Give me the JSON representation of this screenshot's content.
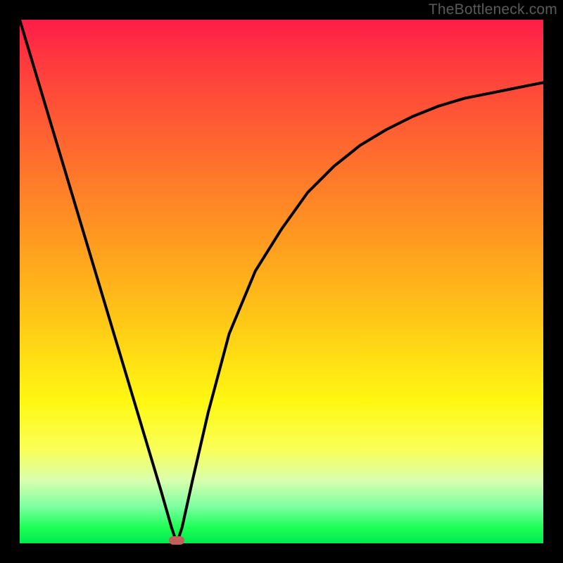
{
  "watermark": "TheBottleneck.com",
  "chart_data": {
    "type": "line",
    "title": "",
    "xlabel": "",
    "ylabel": "",
    "xlim": [
      0,
      100
    ],
    "ylim": [
      0,
      100
    ],
    "series": [
      {
        "name": "bottleneck-curve",
        "x": [
          0,
          3,
          6,
          9,
          12,
          15,
          18,
          21,
          24,
          27,
          29,
          30,
          31,
          33,
          36,
          40,
          45,
          50,
          55,
          60,
          65,
          70,
          75,
          80,
          85,
          90,
          95,
          100
        ],
        "y": [
          100,
          90,
          80,
          70,
          60,
          50,
          40,
          30,
          20,
          10,
          3,
          0,
          3,
          12,
          25,
          40,
          52,
          60,
          67,
          72,
          76,
          79,
          81.5,
          83.5,
          85,
          86,
          87,
          88
        ]
      }
    ],
    "marker": {
      "x": 30,
      "y": 0.5,
      "color": "#c06058"
    },
    "background_gradient": {
      "top": "#ff1c47",
      "bottom": "#00e94e"
    }
  }
}
